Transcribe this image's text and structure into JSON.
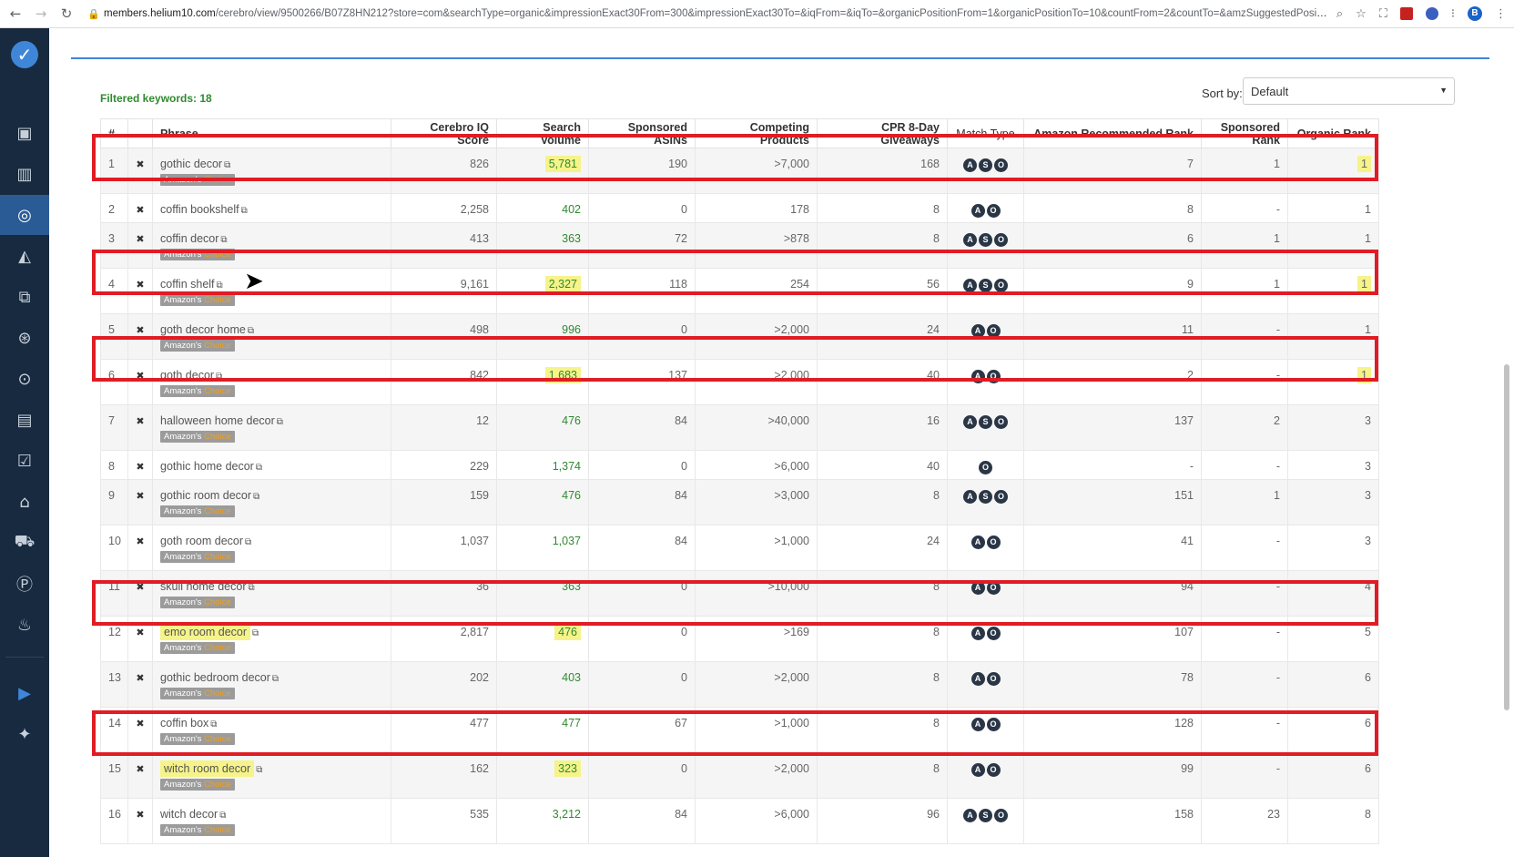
{
  "browser": {
    "url_host": "members.helium10.com",
    "url_path": "/cerebro/view/9500266/B07Z8HN212?store=com&searchType=organic&impressionExact30From=300&impressionExact30To=&iqFrom=&iqTo=&organicPositionFrom=1&organicPositionTo=10&countFrom=2&countTo=&amzSuggestedPositionFrom=&amzSuggestedPositio...",
    "profile_initial": "B"
  },
  "filtered_label": "Filtered keywords: 18",
  "sort": {
    "label": "Sort by:",
    "value": "Default"
  },
  "choice_badge": {
    "part1": "Amazon's",
    "part2": "Choice"
  },
  "columns": [
    "#",
    "",
    "Phrase",
    "Cerebro IQ Score",
    "Search Volume",
    "Sponsored ASINs",
    "Competing Products",
    "CPR 8-Day Giveaways",
    "Match Type",
    "Amazon Recommended Rank",
    "Sponsored Rank",
    "Organic Rank"
  ],
  "rows": [
    {
      "n": "1",
      "phrase": "gothic decor",
      "choice": true,
      "iq": "826",
      "vol": "5,781",
      "sasins": "190",
      "comp": ">7,000",
      "cpr": "168",
      "match": [
        "A",
        "S",
        "O"
      ],
      "arr": "7",
      "srank": "1",
      "orank": "1"
    },
    {
      "n": "2",
      "phrase": "coffin bookshelf",
      "choice": false,
      "iq": "2,258",
      "vol": "402",
      "sasins": "0",
      "comp": "178",
      "cpr": "8",
      "match": [
        "A",
        "O"
      ],
      "arr": "8",
      "srank": "-",
      "orank": "1"
    },
    {
      "n": "3",
      "phrase": "coffin decor",
      "choice": true,
      "iq": "413",
      "vol": "363",
      "sasins": "72",
      "comp": ">878",
      "cpr": "8",
      "match": [
        "A",
        "S",
        "O"
      ],
      "arr": "6",
      "srank": "1",
      "orank": "1"
    },
    {
      "n": "4",
      "phrase": "coffin shelf",
      "choice": true,
      "iq": "9,161",
      "vol": "2,327",
      "sasins": "118",
      "comp": "254",
      "cpr": "56",
      "match": [
        "A",
        "S",
        "O"
      ],
      "arr": "9",
      "srank": "1",
      "orank": "1"
    },
    {
      "n": "5",
      "phrase": "goth decor home",
      "choice": true,
      "iq": "498",
      "vol": "996",
      "sasins": "0",
      "comp": ">2,000",
      "cpr": "24",
      "match": [
        "A",
        "O"
      ],
      "arr": "11",
      "srank": "-",
      "orank": "1"
    },
    {
      "n": "6",
      "phrase": "goth decor",
      "choice": true,
      "iq": "842",
      "vol": "1,683",
      "sasins": "137",
      "comp": ">2,000",
      "cpr": "40",
      "match": [
        "A",
        "O"
      ],
      "arr": "2",
      "srank": "-",
      "orank": "1"
    },
    {
      "n": "7",
      "phrase": "halloween home decor",
      "choice": true,
      "iq": "12",
      "vol": "476",
      "sasins": "84",
      "comp": ">40,000",
      "cpr": "16",
      "match": [
        "A",
        "S",
        "O"
      ],
      "arr": "137",
      "srank": "2",
      "orank": "3"
    },
    {
      "n": "8",
      "phrase": "gothic home decor",
      "choice": false,
      "iq": "229",
      "vol": "1,374",
      "sasins": "0",
      "comp": ">6,000",
      "cpr": "40",
      "match": [
        "O"
      ],
      "arr": "-",
      "srank": "-",
      "orank": "3"
    },
    {
      "n": "9",
      "phrase": "gothic room decor",
      "choice": true,
      "iq": "159",
      "vol": "476",
      "sasins": "84",
      "comp": ">3,000",
      "cpr": "8",
      "match": [
        "A",
        "S",
        "O"
      ],
      "arr": "151",
      "srank": "1",
      "orank": "3"
    },
    {
      "n": "10",
      "phrase": "goth room decor",
      "choice": true,
      "iq": "1,037",
      "vol": "1,037",
      "sasins": "84",
      "comp": ">1,000",
      "cpr": "24",
      "match": [
        "A",
        "O"
      ],
      "arr": "41",
      "srank": "-",
      "orank": "3"
    },
    {
      "n": "11",
      "phrase": "skull home decor",
      "choice": true,
      "iq": "36",
      "vol": "363",
      "sasins": "0",
      "comp": ">10,000",
      "cpr": "8",
      "match": [
        "A",
        "O"
      ],
      "arr": "94",
      "srank": "-",
      "orank": "4"
    },
    {
      "n": "12",
      "phrase": "emo room decor",
      "choice": true,
      "iq": "2,817",
      "vol": "476",
      "sasins": "0",
      "comp": ">169",
      "cpr": "8",
      "match": [
        "A",
        "O"
      ],
      "arr": "107",
      "srank": "-",
      "orank": "5"
    },
    {
      "n": "13",
      "phrase": "gothic bedroom decor",
      "choice": true,
      "iq": "202",
      "vol": "403",
      "sasins": "0",
      "comp": ">2,000",
      "cpr": "8",
      "match": [
        "A",
        "O"
      ],
      "arr": "78",
      "srank": "-",
      "orank": "6"
    },
    {
      "n": "14",
      "phrase": "coffin box",
      "choice": true,
      "iq": "477",
      "vol": "477",
      "sasins": "67",
      "comp": ">1,000",
      "cpr": "8",
      "match": [
        "A",
        "O"
      ],
      "arr": "128",
      "srank": "-",
      "orank": "6"
    },
    {
      "n": "15",
      "phrase": "witch room decor",
      "choice": true,
      "iq": "162",
      "vol": "323",
      "sasins": "0",
      "comp": ">2,000",
      "cpr": "8",
      "match": [
        "A",
        "O"
      ],
      "arr": "99",
      "srank": "-",
      "orank": "6"
    },
    {
      "n": "16",
      "phrase": "witch decor",
      "choice": true,
      "iq": "535",
      "vol": "3,212",
      "sasins": "84",
      "comp": ">6,000",
      "cpr": "96",
      "match": [
        "A",
        "S",
        "O"
      ],
      "arr": "158",
      "srank": "23",
      "orank": "8"
    }
  ]
}
